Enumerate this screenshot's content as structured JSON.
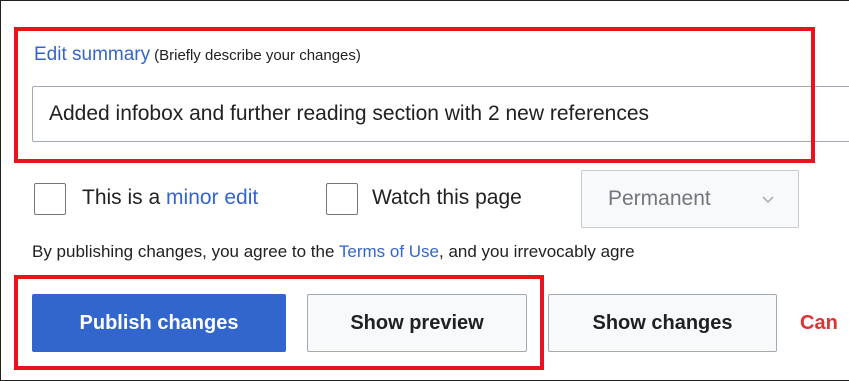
{
  "summary": {
    "label": "Edit summary",
    "hint": "(Briefly describe your changes)",
    "value": "Added infobox and further reading section with 2 new references"
  },
  "options": {
    "minor_prefix": "This is a ",
    "minor_link": "minor edit",
    "watch_label": "Watch this page",
    "watch_period": "Permanent"
  },
  "terms": {
    "prefix": "By publishing changes, you agree to the ",
    "link": "Terms of Use",
    "suffix": ", and you irrevocably agre"
  },
  "buttons": {
    "publish": "Publish changes",
    "preview": "Show preview",
    "changes": "Show changes",
    "cancel": "Can"
  },
  "colors": {
    "accent": "#3366cc",
    "highlight": "#e8131b",
    "destructive": "#dd3333"
  },
  "icons": {
    "dropdown": "chevron-down-icon"
  }
}
